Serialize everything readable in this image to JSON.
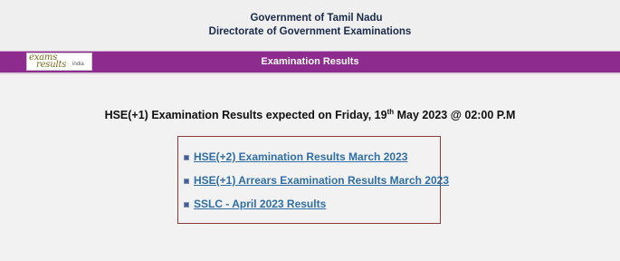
{
  "header": {
    "line1": "Government of Tamil Nadu",
    "line2": "Directorate of Government Examinations"
  },
  "nav_bar": {
    "title": "Examination Results",
    "logo": {
      "word1": "exams",
      "word2": "results",
      "word3": "india"
    },
    "color": "#8e2b8e"
  },
  "announcement": {
    "before": "HSE(+1) Examination Results expected on Friday, 19",
    "superscript": "th",
    "after": " May 2023 @ 02:00 P.M"
  },
  "links": [
    "HSE(+2) Examination Results March 2023",
    "HSE(+1) Arrears Examination Results March 2023",
    "SSLC - April 2023 Results"
  ],
  "colors": {
    "link": "#2f6ea6",
    "box_border": "#8b3a3a",
    "background": "#f3f2f2"
  }
}
